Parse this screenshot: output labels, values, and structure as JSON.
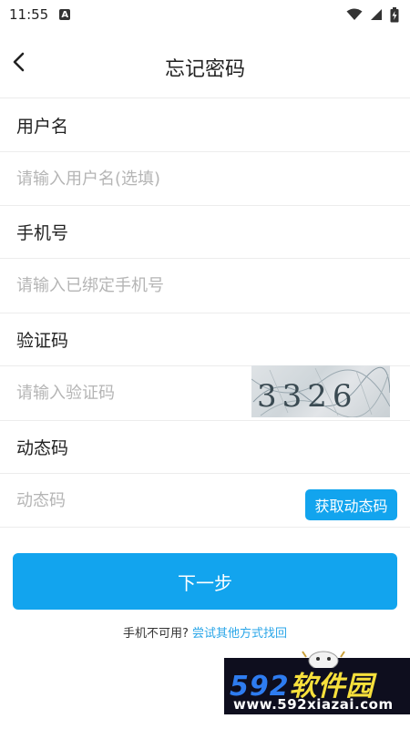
{
  "status": {
    "time": "11:55",
    "notif_badge": "A",
    "wifi_icon": "wifi-icon",
    "battery_icon": "battery-charging-icon"
  },
  "header": {
    "title": "忘记密码",
    "back_icon": "chevron-left-icon"
  },
  "form": {
    "username_label": "用户名",
    "username_placeholder": "请输入用户名(选填)",
    "phone_label": "手机号",
    "phone_placeholder": "请输入已绑定手机号",
    "captcha_label": "验证码",
    "captcha_placeholder": "请输入验证码",
    "captcha_text": "3326",
    "otp_label": "动态码",
    "otp_placeholder": "动态码",
    "otp_button": "获取动态码"
  },
  "actions": {
    "next_button": "下一步",
    "alt_prefix": "手机不可用?",
    "alt_link": "尝试其他方式找回"
  },
  "watermark": {
    "brand_num": "592",
    "brand_cn": "软件园",
    "url": "www.592xiazai.com"
  },
  "colors": {
    "accent": "#12a4ee",
    "link": "#2aa6e8",
    "divider": "#ececec"
  }
}
